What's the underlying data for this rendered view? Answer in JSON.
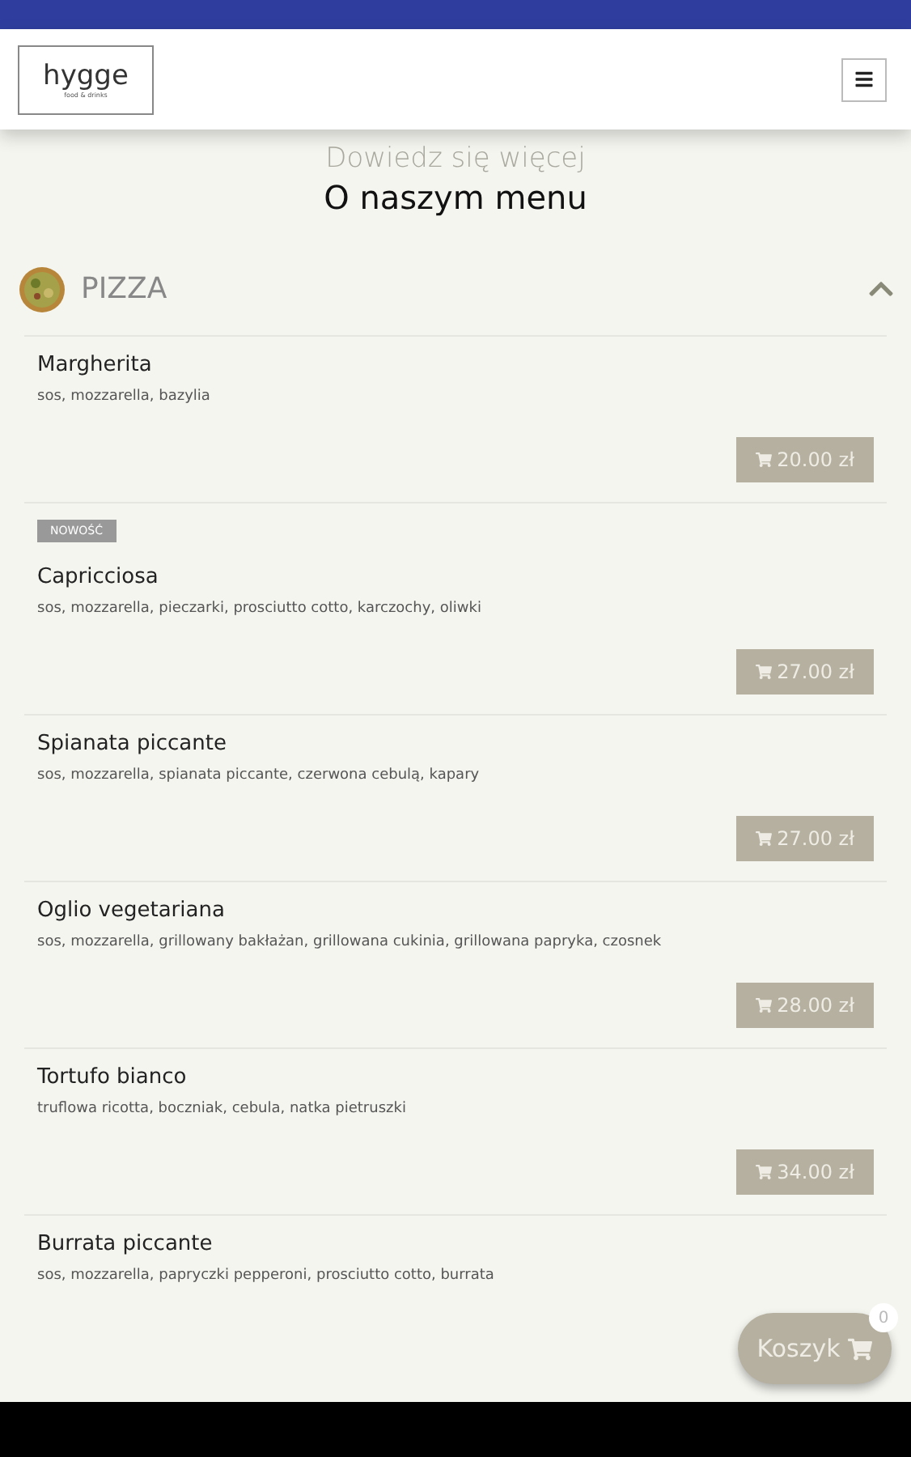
{
  "header": {
    "logo": "hygge",
    "logo_tagline": "food & drinks"
  },
  "intro": {
    "subtitle": "Dowiedz się więcej",
    "title": "O naszym menu"
  },
  "category": {
    "name": "PIZZA",
    "expanded": true
  },
  "items": [
    {
      "name": "Margherita",
      "description": "sos, mozzarella, bazylia",
      "price": "20.00 zł"
    },
    {
      "badge": "NOWOŚĆ",
      "name": "Capricciosa",
      "description": "sos, mozzarella, pieczarki, prosciutto cotto, karczochy, oliwki",
      "price": "27.00 zł"
    },
    {
      "name": "Spianata piccante",
      "description": "sos, mozzarella, spianata piccante, czerwona cebulą, kapary",
      "price": "27.00 zł"
    },
    {
      "name": "Oglio vegetariana",
      "description": "sos, mozzarella, grillowany bakłażan, grillowana cukinia, grillowana papryka, czosnek",
      "price": "28.00 zł"
    },
    {
      "name": "Tortufo bianco",
      "description": "truflowa ricotta, boczniak, cebula, natka pietruszki",
      "price": "34.00 zł"
    },
    {
      "name": "Burrata piccante",
      "description": "sos, mozzarella, papryczki pepperoni, prosciutto cotto, burrata"
    }
  ],
  "cart": {
    "label": "Koszyk",
    "count": "0"
  }
}
